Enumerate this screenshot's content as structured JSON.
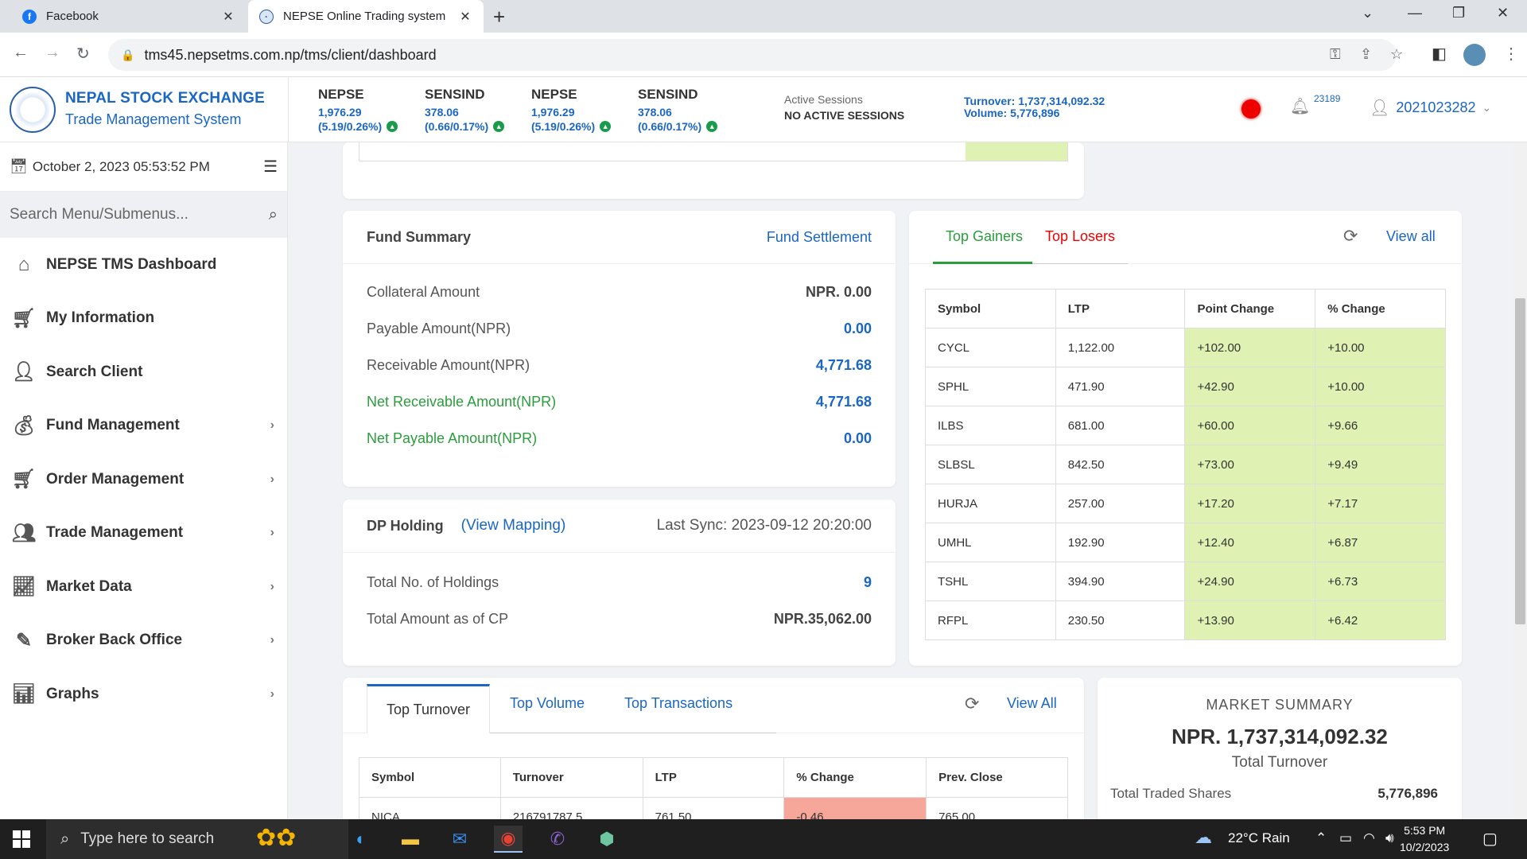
{
  "browser": {
    "tabs": [
      {
        "title": "Facebook",
        "active": false
      },
      {
        "title": "NEPSE Online Trading system",
        "active": true
      }
    ],
    "url": "tms45.nepsetms.com.np/tms/client/dashboard"
  },
  "header": {
    "brand_title": "NEPAL STOCK EXCHANGE",
    "brand_subtitle": "Trade Management System",
    "indices": [
      {
        "name": "NEPSE",
        "value": "1,976.29",
        "change": "(5.19/0.26%)"
      },
      {
        "name": "SENSIND",
        "value": "378.06",
        "change": "(0.66/0.17%)"
      },
      {
        "name": "NEPSE",
        "value": "1,976.29",
        "change": "(5.19/0.26%)"
      },
      {
        "name": "SENSIND",
        "value": "378.06",
        "change": "(0.66/0.17%)"
      }
    ],
    "sessions_label": "Active Sessions",
    "sessions_value": "NO ACTIVE SESSIONS",
    "turnover_line": "Turnover: 1,737,314,092.32",
    "volume_line": "Volume: 5,776,896",
    "notification_count": "23189",
    "user_id": "2021023282",
    "status_color": "#e00000"
  },
  "sidebar": {
    "datetime": "October 2, 2023 05:53:52 PM",
    "search_placeholder": "Search Menu/Submenus...",
    "items": [
      {
        "label": "NEPSE TMS Dashboard",
        "icon": "home-icon",
        "has_submenu": false
      },
      {
        "label": "My Information",
        "icon": "cart-icon",
        "has_submenu": false
      },
      {
        "label": "Search Client",
        "icon": "user-search-icon",
        "has_submenu": false
      },
      {
        "label": "Fund Management",
        "icon": "money-bag-icon",
        "has_submenu": true
      },
      {
        "label": "Order Management",
        "icon": "cart-icon",
        "has_submenu": true
      },
      {
        "label": "Trade Management",
        "icon": "people-icon",
        "has_submenu": true
      },
      {
        "label": "Market Data",
        "icon": "chart-icon",
        "has_submenu": true
      },
      {
        "label": "Broker Back Office",
        "icon": "edit-icon",
        "has_submenu": true
      },
      {
        "label": "Graphs",
        "icon": "bar-chart-icon",
        "has_submenu": true
      }
    ]
  },
  "fund_summary": {
    "title": "Fund Summary",
    "link": "Fund Settlement",
    "rows": [
      {
        "label": "Collateral Amount",
        "value": "NPR. 0.00"
      },
      {
        "label": "Payable Amount(NPR)",
        "value": "0.00"
      },
      {
        "label": "Receivable Amount(NPR)",
        "value": "4,771.68"
      },
      {
        "label": "Net Receivable Amount(NPR)",
        "value": "4,771.68"
      },
      {
        "label": "Net Payable Amount(NPR)",
        "value": "0.00"
      }
    ]
  },
  "dp_holding": {
    "title": "DP Holding",
    "view_mapping": "(View Mapping)",
    "last_sync": "Last Sync: 2023-09-12 20:20:00",
    "rows": [
      {
        "label": "Total No. of Holdings",
        "value": "9"
      },
      {
        "label": "Total Amount as of CP",
        "value": "NPR.35,062.00"
      }
    ]
  },
  "gainers": {
    "tab_gainers": "Top Gainers",
    "tab_losers": "Top Losers",
    "view_all": "View all",
    "headers": [
      "Symbol",
      "LTP",
      "Point Change",
      "% Change"
    ],
    "rows": [
      [
        "CYCL",
        "1,122.00",
        "+102.00",
        "+10.00"
      ],
      [
        "SPHL",
        "471.90",
        "+42.90",
        "+10.00"
      ],
      [
        "ILBS",
        "681.00",
        "+60.00",
        "+9.66"
      ],
      [
        "SLBSL",
        "842.50",
        "+73.00",
        "+9.49"
      ],
      [
        "HURJA",
        "257.00",
        "+17.20",
        "+7.17"
      ],
      [
        "UMHL",
        "192.90",
        "+12.40",
        "+6.87"
      ],
      [
        "TSHL",
        "394.90",
        "+24.90",
        "+6.73"
      ],
      [
        "RFPL",
        "230.50",
        "+13.90",
        "+6.42"
      ]
    ]
  },
  "turnover_panel": {
    "tabs": [
      "Top Turnover",
      "Top Volume",
      "Top Transactions"
    ],
    "view_all": "View All",
    "headers": [
      "Symbol",
      "Turnover",
      "LTP",
      "% Change",
      "Prev. Close"
    ],
    "rows": [
      [
        "NICA",
        "216791787.5",
        "761.50",
        "-0.46",
        "765.00"
      ]
    ]
  },
  "market_summary": {
    "title": "MARKET SUMMARY",
    "amount": "NPR. 1,737,314,092.32",
    "amount_label": "Total Turnover",
    "traded_shares_label": "Total Traded Shares",
    "traded_shares_value": "5,776,896"
  },
  "taskbar": {
    "search_placeholder": "Type here to search",
    "weather": "22°C  Rain",
    "time": "5:53 PM",
    "date": "10/2/2023"
  }
}
